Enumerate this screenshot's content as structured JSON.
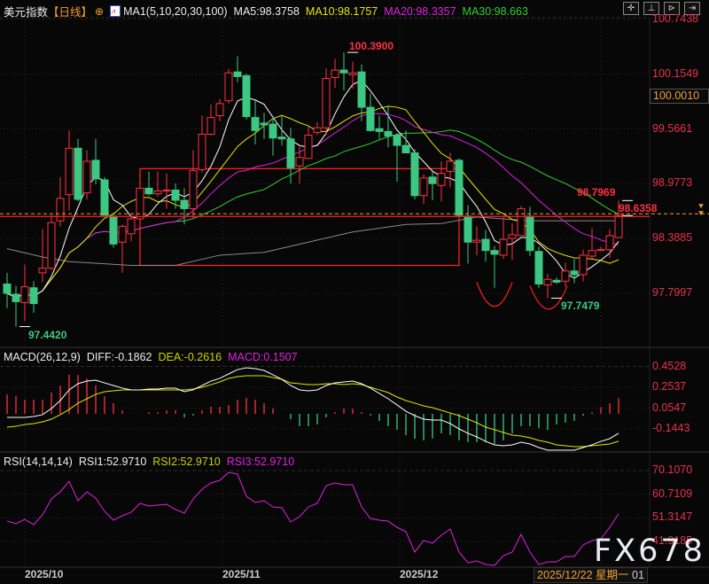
{
  "header": {
    "symbol": "美元指数",
    "period": "【日线】",
    "indicator": "MA1(5,10,20,30,100)",
    "ma5": "MA5:98.3758",
    "ma10": "MA10:98.1757",
    "ma20": "MA20:98.3357",
    "ma30": "MA30:98.663"
  },
  "toolbar_icons": [
    "crosshair-icon",
    "zoom-in-icon",
    "zoom-out-icon",
    "next-icon"
  ],
  "macd_header": {
    "name": "MACD(26,12,9)",
    "diff": "DIFF:-0.1862",
    "dea": "DEA:-0.2616",
    "macd": "MACD:0.1507"
  },
  "rsi_header": {
    "name": "RSI(14,14,14)",
    "rsi1": "RSI1:52.9710",
    "rsi2": "RSI2:52.9710",
    "rsi3": "RSI3:52.9710"
  },
  "watermark": "FX678",
  "cursor_date": "2025/12/22 星期一",
  "cursor_suffix": "01",
  "colors": {
    "up": "#ff3040",
    "down": "#3cc883",
    "ma5": "#ffffff",
    "ma10": "#e6e600",
    "ma20": "#e020e0",
    "ma30": "#30d030",
    "ma100": "#8a8a8a",
    "axis": "#e8324a",
    "accent": "#f0a030"
  },
  "chart_data": [
    {
      "type": "candlestick",
      "panel": "price",
      "ohlc": [
        [
          97.9,
          98.02,
          97.64,
          97.8
        ],
        [
          97.79,
          97.88,
          97.442,
          97.71
        ],
        [
          97.7,
          98.11,
          97.5,
          97.87
        ],
        [
          97.86,
          97.93,
          97.59,
          97.69
        ],
        [
          98.02,
          98.49,
          97.92,
          98.07
        ],
        [
          98.07,
          98.64,
          98.05,
          98.56
        ],
        [
          98.58,
          99.05,
          98.52,
          98.82
        ],
        [
          98.86,
          99.55,
          98.69,
          99.36
        ],
        [
          99.36,
          99.46,
          98.79,
          98.81
        ],
        [
          98.88,
          99.34,
          98.81,
          99.22
        ],
        [
          99.23,
          99.46,
          98.97,
          99.03
        ],
        [
          99.02,
          99.05,
          98.64,
          98.64
        ],
        [
          98.63,
          98.64,
          98.29,
          98.33
        ],
        [
          98.35,
          98.54,
          98.02,
          98.52
        ],
        [
          98.44,
          98.64,
          98.36,
          98.6
        ],
        [
          98.6,
          98.93,
          98.6,
          98.93
        ],
        [
          98.93,
          99.11,
          98.85,
          98.87
        ],
        [
          98.87,
          99.11,
          98.84,
          98.9
        ],
        [
          98.9,
          99.09,
          98.71,
          98.91
        ],
        [
          98.91,
          98.98,
          98.71,
          98.8
        ],
        [
          98.8,
          98.93,
          98.54,
          98.71
        ],
        [
          98.71,
          99.34,
          98.6,
          99.12
        ],
        [
          99.13,
          99.71,
          99.1,
          99.51
        ],
        [
          99.51,
          99.83,
          99.5,
          99.69
        ],
        [
          99.71,
          99.89,
          99.65,
          99.84
        ],
        [
          99.87,
          100.21,
          99.84,
          100.17
        ],
        [
          100.18,
          100.35,
          100.07,
          100.13
        ],
        [
          100.14,
          100.16,
          99.67,
          99.7
        ],
        [
          99.69,
          99.87,
          99.4,
          99.55
        ],
        [
          99.63,
          99.74,
          99.46,
          99.61
        ],
        [
          99.62,
          99.71,
          99.28,
          99.47
        ],
        [
          99.48,
          99.71,
          99.39,
          99.46
        ],
        [
          99.46,
          99.58,
          98.98,
          99.15
        ],
        [
          99.17,
          99.39,
          98.98,
          99.26
        ],
        [
          99.25,
          99.59,
          99.25,
          99.5
        ],
        [
          99.53,
          99.64,
          99.5,
          99.58
        ],
        [
          99.58,
          100.22,
          99.5,
          100.11
        ],
        [
          100.12,
          100.32,
          100.01,
          100.2
        ],
        [
          100.2,
          100.39,
          99.98,
          100.17
        ],
        [
          100.15,
          100.29,
          100.0,
          100.17
        ],
        [
          100.18,
          100.26,
          99.65,
          99.8
        ],
        [
          99.8,
          99.95,
          99.54,
          99.55
        ],
        [
          99.57,
          99.71,
          99.46,
          99.54
        ],
        [
          99.54,
          99.82,
          99.37,
          99.49
        ],
        [
          99.5,
          99.52,
          99.0,
          99.39
        ],
        [
          99.39,
          99.55,
          99.31,
          99.31
        ],
        [
          99.31,
          99.35,
          98.81,
          98.85
        ],
        [
          98.85,
          99.08,
          98.76,
          99.04
        ],
        [
          99.05,
          99.11,
          98.8,
          98.98
        ],
        [
          98.96,
          99.22,
          98.79,
          99.09
        ],
        [
          99.11,
          99.31,
          98.94,
          99.22
        ],
        [
          99.23,
          99.25,
          98.64,
          98.64
        ],
        [
          98.63,
          98.75,
          98.12,
          98.35
        ],
        [
          98.35,
          98.52,
          98.21,
          98.37
        ],
        [
          98.38,
          98.48,
          98.14,
          98.26
        ],
        [
          98.26,
          98.31,
          97.86,
          98.22
        ],
        [
          98.21,
          98.62,
          98.17,
          98.38
        ],
        [
          98.39,
          98.55,
          98.16,
          98.43
        ],
        [
          98.42,
          98.74,
          98.42,
          98.71
        ],
        [
          98.63,
          98.73,
          98.2,
          98.26
        ],
        [
          98.25,
          98.3,
          97.86,
          97.9
        ],
        [
          97.89,
          98.01,
          97.7479,
          97.95
        ],
        [
          97.94,
          97.97,
          97.9,
          97.92
        ],
        [
          97.93,
          98.13,
          97.87,
          98.04
        ],
        [
          98.04,
          98.17,
          97.91,
          98.0
        ],
        [
          98.0,
          98.27,
          97.93,
          98.21
        ],
        [
          98.2,
          98.5,
          98.17,
          98.26
        ],
        [
          98.26,
          98.3,
          98.26,
          98.27
        ],
        [
          98.27,
          98.49,
          98.18,
          98.42
        ],
        [
          98.4,
          98.7969,
          98.4,
          98.6358
        ]
      ],
      "ma_periods": [
        5,
        10,
        20,
        30
      ],
      "ma100_samples": [
        [
          0,
          98.28
        ],
        [
          4,
          98.19
        ],
        [
          7,
          98.14
        ],
        [
          14,
          98.1
        ],
        [
          19,
          98.1
        ],
        [
          24,
          98.21
        ],
        [
          29,
          98.24
        ],
        [
          34,
          98.35
        ],
        [
          39,
          98.46
        ],
        [
          45,
          98.54
        ],
        [
          49,
          98.55
        ],
        [
          53,
          98.62
        ],
        [
          59,
          98.58
        ],
        [
          69,
          98.58
        ]
      ],
      "ylim": [
        97.7997,
        100.7438
      ],
      "y_ticks": [
        "100.7438",
        "100.1549",
        "99.5661",
        "98.9773",
        "98.3885",
        "97.7997"
      ],
      "crosshair_price": "100.0010",
      "last_price": 98.6358,
      "annotations": [
        {
          "text": "100.3900",
          "index": 39,
          "price": 100.39,
          "color": "#ff3040"
        },
        {
          "text": "98.7969",
          "index": 70,
          "price": 98.7969,
          "color": "#ff3040"
        },
        {
          "text": "98.6358",
          "index": 70,
          "price": 98.6358,
          "color": "#ff3040"
        },
        {
          "text": "97.7479",
          "index": 62,
          "price": 97.7479,
          "color": "#3cc883"
        },
        {
          "text": "97.4420",
          "index": 2,
          "price": 97.442,
          "color": "#3cc883"
        }
      ],
      "box": {
        "start_index": 15,
        "end_index": 51,
        "top": 99.14,
        "bottom": 98.1
      },
      "arcs": [
        {
          "start_index": 53,
          "end_index": 57,
          "top": 97.92,
          "bottom": 97.66
        },
        {
          "start_index": 59,
          "end_index": 63.2,
          "top": 97.88,
          "bottom": 97.63
        }
      ]
    },
    {
      "type": "line",
      "panel": "macd",
      "diff": [
        -0.034,
        -0.034,
        -0.034,
        -0.025,
        -0.008,
        0.051,
        0.127,
        0.229,
        0.288,
        0.313,
        0.322,
        0.296,
        0.271,
        0.246,
        0.229,
        0.229,
        0.237,
        0.237,
        0.246,
        0.246,
        0.212,
        0.229,
        0.271,
        0.313,
        0.339,
        0.381,
        0.423,
        0.44,
        0.432,
        0.415,
        0.373,
        0.33,
        0.271,
        0.229,
        0.22,
        0.229,
        0.271,
        0.296,
        0.305,
        0.313,
        0.288,
        0.246,
        0.195,
        0.144,
        0.085,
        0.025,
        -0.017,
        -0.051,
        -0.059,
        -0.059,
        -0.093,
        -0.144,
        -0.186,
        -0.22,
        -0.263,
        -0.296,
        -0.305,
        -0.296,
        -0.271,
        -0.288,
        -0.322,
        -0.347,
        -0.347,
        -0.347,
        -0.347,
        -0.322,
        -0.296,
        -0.263,
        -0.237,
        -0.1862
      ],
      "dea": [
        -0.127,
        -0.119,
        -0.102,
        -0.093,
        -0.076,
        -0.051,
        -0.008,
        0.042,
        0.102,
        0.144,
        0.186,
        0.212,
        0.22,
        0.229,
        0.229,
        0.229,
        0.229,
        0.229,
        0.229,
        0.229,
        0.229,
        0.237,
        0.254,
        0.279,
        0.305,
        0.339,
        0.356,
        0.364,
        0.364,
        0.364,
        0.347,
        0.33,
        0.296,
        0.288,
        0.279,
        0.279,
        0.288,
        0.288,
        0.279,
        0.288,
        0.279,
        0.254,
        0.229,
        0.203,
        0.161,
        0.127,
        0.102,
        0.076,
        0.059,
        0.034,
        0.008,
        -0.017,
        -0.051,
        -0.085,
        -0.127,
        -0.152,
        -0.178,
        -0.203,
        -0.212,
        -0.229,
        -0.254,
        -0.271,
        -0.296,
        -0.305,
        -0.313,
        -0.313,
        -0.305,
        -0.296,
        -0.288,
        -0.2616
      ],
      "histogram": "2*(DIFF-DEA)",
      "y_ticks": [
        "0.4528",
        "0.2537",
        "0.0547",
        "-0.1443"
      ]
    },
    {
      "type": "line",
      "panel": "rsi",
      "rsi": [
        50.02,
        48.96,
        50.72,
        48.61,
        52.49,
        58.83,
        61.65,
        65.88,
        58.13,
        61.65,
        59.18,
        53.9,
        50.37,
        52.13,
        53.55,
        57.07,
        56.01,
        56.36,
        56.72,
        54.6,
        53.19,
        58.83,
        62.71,
        65.17,
        66.23,
        69.4,
        68.7,
        59.89,
        57.42,
        58.13,
        55.66,
        55.31,
        49.67,
        51.78,
        55.66,
        57.07,
        64.12,
        65.17,
        64.47,
        64.47,
        55.66,
        51.08,
        50.37,
        50.02,
        47.55,
        45.79,
        37.69,
        42.27,
        41.21,
        44.38,
        46.85,
        37.69,
        33.46,
        34.16,
        32.75,
        32.4,
        36.28,
        37.69,
        44.73,
        37.69,
        32.75,
        33.81,
        33.81,
        35.92,
        35.92,
        40.51,
        42.27,
        42.97,
        47.55,
        52.97
      ],
      "y_ticks": [
        "70.1070",
        "60.7109",
        "51.3147",
        "41.9185"
      ]
    },
    {
      "x_labels": [
        {
          "label": "2025/10",
          "index": 1
        },
        {
          "label": "2025/11",
          "index": 24
        },
        {
          "label": "2025/12",
          "index": 44
        }
      ]
    }
  ]
}
